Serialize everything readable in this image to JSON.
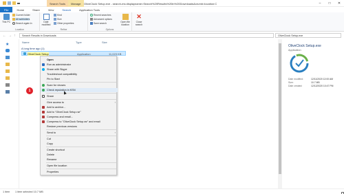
{
  "window": {
    "title": "OliveClock Setup.exe - search-ms:displayname=Search%20Results%20in%20Downloads&crumb=location:C",
    "context_tabs": [
      "Search Tools",
      "Manage"
    ],
    "controls": [
      "–",
      "□",
      "✕"
    ]
  },
  "ribbon": {
    "tabs": [
      "File",
      "Home",
      "Share",
      "View",
      "Search",
      "Application Tools"
    ],
    "active_tab": "Search",
    "groups": {
      "location": {
        "label": "Location",
        "big": "This PC",
        "small": [
          "Current folder",
          "All subfolders",
          "Search again in"
        ]
      },
      "refine": {
        "label": "Refine",
        "big": "Date modified",
        "small": [
          "Kind",
          "Size",
          "Other properties"
        ]
      },
      "options": {
        "label": "Options",
        "small": [
          "Recent searches",
          "Advanced options",
          "Save search"
        ],
        "big": "Open file location"
      },
      "close": {
        "big": "Close search"
      }
    }
  },
  "address": {
    "path": "Search Results in Downloads",
    "search_value": "OliveClock Setup.exe"
  },
  "file_list": {
    "columns": [
      "Name",
      "Type",
      "Size"
    ],
    "group_header": "A long time ago (1)",
    "row": {
      "name": "OliveClock Setup",
      "type": "Application",
      "size": "11,023 KB"
    }
  },
  "context_menu": {
    "items": [
      {
        "label": "Open",
        "bold": true,
        "icon": "open-icon"
      },
      {
        "label": "Run as administrator",
        "icon": "shield-icon",
        "icon_color": "#2d6cc0"
      },
      {
        "label": "Share with Skype",
        "icon": "skype-icon",
        "icon_color": "#00aff0"
      },
      {
        "label": "Troubleshoot compatibility"
      },
      {
        "label": "Pin to Start"
      },
      {
        "label": "Scan for viruses",
        "icon": "scan-icon",
        "icon_color": "#3aa757"
      },
      {
        "label": "Check reputation in KSN",
        "icon": "ksn-icon",
        "icon_color": "#3aa757",
        "highlight": true
      },
      {
        "label": "Share",
        "icon": "share-icon"
      },
      {
        "label": "Give access to",
        "submenu": true
      },
      {
        "label": "Add to archive...",
        "icon": "archive-icon",
        "icon_color": "#b33a3a"
      },
      {
        "label": "Add to \"OliveClock Setup.rar\"",
        "icon": "archive-icon",
        "icon_color": "#b33a3a"
      },
      {
        "label": "Compress and email...",
        "icon": "archive-icon",
        "icon_color": "#b33a3a"
      },
      {
        "label": "Compress to \"OliveClock Setup.rar\" and email",
        "icon": "archive-icon",
        "icon_color": "#b33a3a"
      },
      {
        "label": "Restore previous versions"
      },
      {
        "label": "Send to",
        "submenu": true
      },
      {
        "label": "Cut"
      },
      {
        "label": "Copy"
      },
      {
        "label": "Create shortcut"
      },
      {
        "label": "Delete"
      },
      {
        "label": "Rename"
      },
      {
        "label": "Open file location"
      },
      {
        "label": "Properties"
      }
    ]
  },
  "annotation": {
    "badge_number": "1",
    "badge_color": "#e0212a"
  },
  "preview": {
    "title": "OliveClock Setup.exe",
    "subtitle": "Application",
    "properties": [
      {
        "name": "Date modified:",
        "value": "12/11/2020 12:00 AM"
      },
      {
        "name": "Size:",
        "value": "10.7 MB"
      },
      {
        "name": "Date created:",
        "value": "12/12/2020 10:47 PM"
      }
    ]
  },
  "status": {
    "items": "1 item",
    "selected": "1 item selected  10.7 MB"
  },
  "colors": {
    "accent": "#1a73c9",
    "selection": "#cce8ff",
    "search_tab": "#f9d8a8",
    "manage_tab": "#f6e2a2"
  }
}
